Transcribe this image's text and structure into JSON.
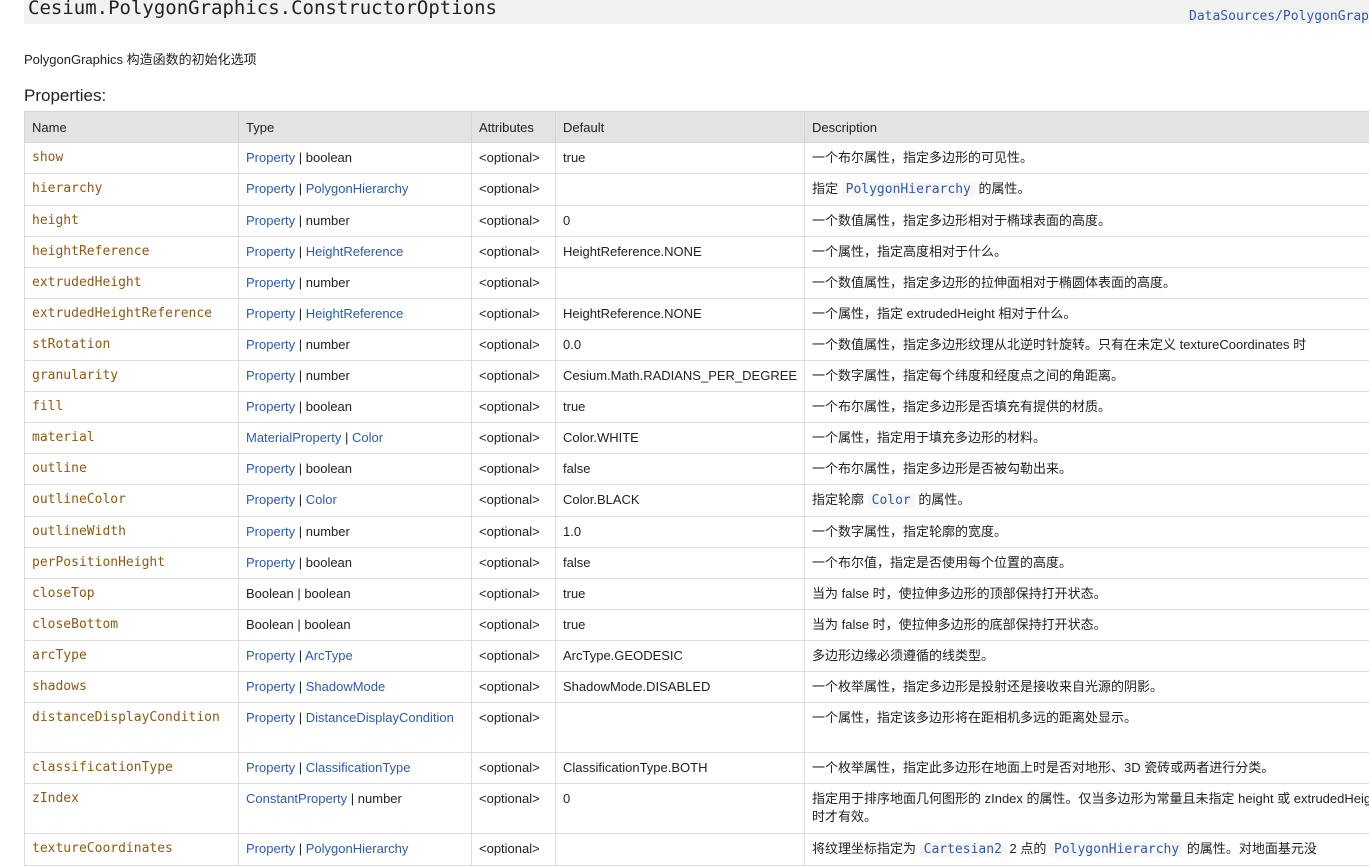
{
  "header": {
    "title": "Cesium.PolygonGraphics.ConstructorOptions",
    "source_link": "DataSources/PolygonGraphics"
  },
  "description": "PolygonGraphics 构造函数的初始化选项",
  "properties_heading": "Properties:",
  "columns": [
    "Name",
    "Type",
    "Attributes",
    "Default",
    "Description"
  ],
  "rows": [
    {
      "name": "show",
      "type": [
        [
          "Property",
          true
        ],
        [
          "boolean",
          false
        ]
      ],
      "attr": "<optional>",
      "default": "true",
      "desc": [
        [
          "一个布尔属性，指定多边形的可见性。",
          false
        ]
      ]
    },
    {
      "name": "hierarchy",
      "type": [
        [
          "Property",
          true
        ],
        [
          "PolygonHierarchy",
          true
        ]
      ],
      "attr": "<optional>",
      "default": "",
      "desc": [
        [
          "指定 ",
          false
        ],
        [
          "PolygonHierarchy",
          true
        ],
        [
          " 的属性。",
          false
        ]
      ]
    },
    {
      "name": "height",
      "type": [
        [
          "Property",
          true
        ],
        [
          "number",
          false
        ]
      ],
      "attr": "<optional>",
      "default": "0",
      "desc": [
        [
          "一个数值属性，指定多边形相对于椭球表面的高度。",
          false
        ]
      ]
    },
    {
      "name": "heightReference",
      "type": [
        [
          "Property",
          true
        ],
        [
          "HeightReference",
          true
        ]
      ],
      "attr": "<optional>",
      "default": "HeightReference.NONE",
      "desc": [
        [
          "一个属性，指定高度相对于什么。",
          false
        ]
      ]
    },
    {
      "name": "extrudedHeight",
      "type": [
        [
          "Property",
          true
        ],
        [
          "number",
          false
        ]
      ],
      "attr": "<optional>",
      "default": "",
      "desc": [
        [
          "一个数值属性，指定多边形的拉伸面相对于椭圆体表面的高度。",
          false
        ]
      ]
    },
    {
      "name": "extrudedHeightReference",
      "type": [
        [
          "Property",
          true
        ],
        [
          "HeightReference",
          true
        ]
      ],
      "attr": "<optional>",
      "default": "HeightReference.NONE",
      "desc": [
        [
          "一个属性，指定 extrudedHeight 相对于什么。",
          false
        ]
      ]
    },
    {
      "name": "stRotation",
      "type": [
        [
          "Property",
          true
        ],
        [
          "number",
          false
        ]
      ],
      "attr": "<optional>",
      "default": "0.0",
      "desc": [
        [
          "一个数值属性，指定多边形纹理从北逆时针旋转。只有在未定义 textureCoordinates 时",
          false
        ]
      ]
    },
    {
      "name": "granularity",
      "type": [
        [
          "Property",
          true
        ],
        [
          "number",
          false
        ]
      ],
      "attr": "<optional>",
      "default": "Cesium.Math.RADIANS_PER_DEGREE",
      "desc": [
        [
          "一个数字属性，指定每个纬度和经度点之间的角距离。",
          false
        ]
      ]
    },
    {
      "name": "fill",
      "type": [
        [
          "Property",
          true
        ],
        [
          "boolean",
          false
        ]
      ],
      "attr": "<optional>",
      "default": "true",
      "desc": [
        [
          "一个布尔属性，指定多边形是否填充有提供的材质。",
          false
        ]
      ]
    },
    {
      "name": "material",
      "type": [
        [
          "MaterialProperty",
          true
        ],
        [
          "Color",
          true
        ]
      ],
      "attr": "<optional>",
      "default": "Color.WHITE",
      "desc": [
        [
          "一个属性，指定用于填充多边形的材料。",
          false
        ]
      ]
    },
    {
      "name": "outline",
      "type": [
        [
          "Property",
          true
        ],
        [
          "boolean",
          false
        ]
      ],
      "attr": "<optional>",
      "default": "false",
      "desc": [
        [
          "一个布尔属性，指定多边形是否被勾勒出来。",
          false
        ]
      ]
    },
    {
      "name": "outlineColor",
      "type": [
        [
          "Property",
          true
        ],
        [
          "Color",
          true
        ]
      ],
      "attr": "<optional>",
      "default": "Color.BLACK",
      "desc": [
        [
          "指定轮廓 ",
          false
        ],
        [
          "Color",
          true
        ],
        [
          " 的属性。",
          false
        ]
      ]
    },
    {
      "name": "outlineWidth",
      "type": [
        [
          "Property",
          true
        ],
        [
          "number",
          false
        ]
      ],
      "attr": "<optional>",
      "default": "1.0",
      "desc": [
        [
          "一个数字属性，指定轮廓的宽度。",
          false
        ]
      ]
    },
    {
      "name": "perPositionHeight",
      "type": [
        [
          "Property",
          true
        ],
        [
          "boolean",
          false
        ]
      ],
      "attr": "<optional>",
      "default": "false",
      "desc": [
        [
          "一个布尔值，指定是否使用每个位置的高度。",
          false
        ]
      ]
    },
    {
      "name": "closeTop",
      "type": [
        [
          "Boolean",
          false
        ],
        [
          "boolean",
          false
        ]
      ],
      "attr": "<optional>",
      "default": "true",
      "desc": [
        [
          "当为 false 时，使拉伸多边形的顶部保持打开状态。",
          false
        ]
      ]
    },
    {
      "name": "closeBottom",
      "type": [
        [
          "Boolean",
          false
        ],
        [
          "boolean",
          false
        ]
      ],
      "attr": "<optional>",
      "default": "true",
      "desc": [
        [
          "当为 false 时，使拉伸多边形的底部保持打开状态。",
          false
        ]
      ]
    },
    {
      "name": "arcType",
      "type": [
        [
          "Property",
          true
        ],
        [
          "ArcType",
          true
        ]
      ],
      "attr": "<optional>",
      "default": "ArcType.GEODESIC",
      "desc": [
        [
          "多边形边缘必须遵循的线类型。",
          false
        ]
      ]
    },
    {
      "name": "shadows",
      "type": [
        [
          "Property",
          true
        ],
        [
          "ShadowMode",
          true
        ]
      ],
      "attr": "<optional>",
      "default": "ShadowMode.DISABLED",
      "desc": [
        [
          "一个枚举属性，指定多边形是投射还是接收来自光源的阴影。",
          false
        ]
      ]
    },
    {
      "name": "distanceDisplayCondition",
      "type": [
        [
          "Property",
          true
        ],
        [
          "DistanceDisplayCondition",
          true
        ]
      ],
      "attr": "<optional>",
      "default": "",
      "desc": [
        [
          "一个属性，指定该多边形将在距相机多远的距离处显示。",
          false
        ]
      ],
      "tall": true
    },
    {
      "name": "classificationType",
      "type": [
        [
          "Property",
          true
        ],
        [
          "ClassificationType",
          true
        ]
      ],
      "attr": "<optional>",
      "default": "ClassificationType.BOTH",
      "desc": [
        [
          "一个枚举属性，指定此多边形在地面上时是否对地形、3D 瓷砖或两者进行分类。",
          false
        ]
      ]
    },
    {
      "name": "zIndex",
      "type": [
        [
          "ConstantProperty",
          true
        ],
        [
          "number",
          false
        ]
      ],
      "attr": "<optional>",
      "default": "0",
      "desc": [
        [
          "指定用于排序地面几何图形的 zIndex 的属性。仅当多边形为常量且未指定 height 或 extrudedHeight 时才有效。",
          false
        ]
      ],
      "tall": true
    },
    {
      "name": "textureCoordinates",
      "type": [
        [
          "Property",
          true
        ],
        [
          "PolygonHierarchy",
          true
        ]
      ],
      "attr": "<optional>",
      "default": "",
      "desc": [
        [
          "将纹理坐标指定为 ",
          false
        ],
        [
          "Cartesian2",
          true
        ],
        [
          " 2 点的 ",
          false
        ],
        [
          "PolygonHierarchy",
          true
        ],
        [
          " 的属性。对地面基元没",
          false
        ]
      ]
    }
  ]
}
